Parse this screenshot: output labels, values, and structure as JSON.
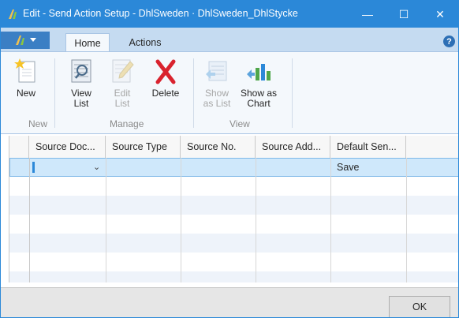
{
  "window": {
    "title": "Edit - Send Action Setup - DhlSweden · DhlSweden_DhlStycke",
    "controls": {
      "minimize": "—",
      "maximize": "☐",
      "close": "✕"
    }
  },
  "ribbon": {
    "tabs": [
      {
        "label": "Home"
      },
      {
        "label": "Actions"
      }
    ],
    "help": "?",
    "buttons": {
      "new": {
        "label": "New",
        "icon": "new-document-icon"
      },
      "view_list": {
        "line1": "View",
        "line2": "List",
        "icon": "view-list-icon"
      },
      "edit_list": {
        "line1": "Edit",
        "line2": "List",
        "icon": "edit-list-icon"
      },
      "delete": {
        "label": "Delete",
        "icon": "delete-x-icon"
      },
      "show_as_list": {
        "line1": "Show",
        "line2": "as List",
        "icon": "show-as-list-icon"
      },
      "show_as_chart": {
        "line1": "Show as",
        "line2": "Chart",
        "icon": "show-as-chart-icon"
      }
    },
    "groups": {
      "new": "New",
      "manage": "Manage",
      "view": "View"
    }
  },
  "grid": {
    "columns": [
      {
        "label": "Source Doc..."
      },
      {
        "label": "Source Type"
      },
      {
        "label": "Source No."
      },
      {
        "label": "Source Add..."
      },
      {
        "label": "Default Sen..."
      }
    ],
    "rows": [
      {
        "source_doc": "",
        "source_type": "",
        "source_no": "",
        "source_add": "",
        "default_send": "Save"
      }
    ]
  },
  "footer": {
    "ok_label": "OK"
  },
  "colors": {
    "accent": "#2b88d8",
    "ribbon_tabstrip": "#c5dbf1",
    "ribbon_body": "#f4f8fc",
    "selected_row": "#cfe8fb",
    "delete_red": "#d9232e"
  }
}
